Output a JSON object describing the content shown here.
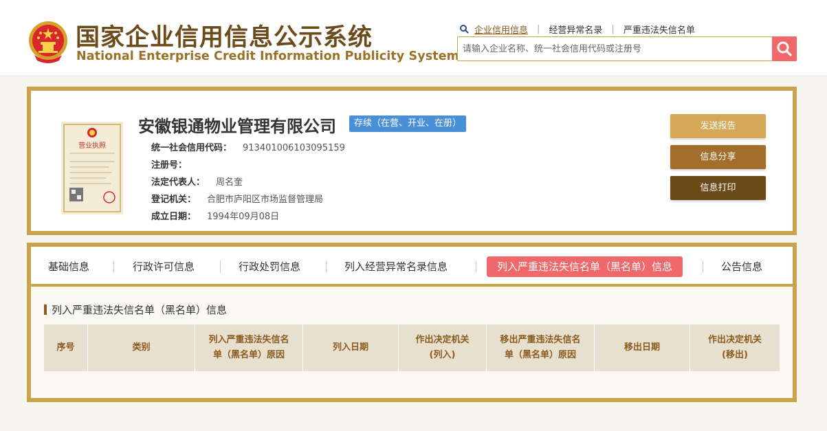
{
  "header": {
    "title_cn": "国家企业信用信息公示系统",
    "title_en": "National Enterprise Credit Information Publicity System",
    "links": [
      "企业信用信息",
      "经营异常名录",
      "严重违法失信名单"
    ],
    "search_placeholder": "请输入企业名称、统一社会信用代码或注册号"
  },
  "company": {
    "name": "安徽银通物业管理有限公司",
    "status": "存续（在营、开业、在册）",
    "fields": [
      {
        "label": "统一社会信用代码：",
        "value": "913401006103095159"
      },
      {
        "label": "注册号：",
        "value": ""
      },
      {
        "label": "法定代表人：",
        "value": "周名奎"
      },
      {
        "label": "登记机关：",
        "value": "合肥市庐阳区市场监督管理局"
      },
      {
        "label": "成立日期：",
        "value": "1994年09月08日"
      }
    ],
    "license_title": "营业执照",
    "buttons": {
      "send": "发送报告",
      "share": "信息分享",
      "print": "信息打印"
    }
  },
  "tabs": [
    "基础信息",
    "行政许可信息",
    "行政处罚信息",
    "列入经营异常名录信息",
    "列入严重违法失信名单（黑名单）信息",
    "公告信息"
  ],
  "active_tab": 4,
  "section": {
    "title": "列入严重违法失信名单（黑名单）信息",
    "columns": [
      "序号",
      "类别",
      "列入严重违法失信名单（黑名单）原因",
      "列入日期",
      "作出决定机关(列入)",
      "移出严重违法失信名单（黑名单）原因",
      "移出日期",
      "作出决定机关(移出)"
    ]
  },
  "colors": {
    "gold": "#c9a24a",
    "brown": "#6b4b1a",
    "accent_red": "#f0686a",
    "status_blue": "#4a90d9"
  }
}
